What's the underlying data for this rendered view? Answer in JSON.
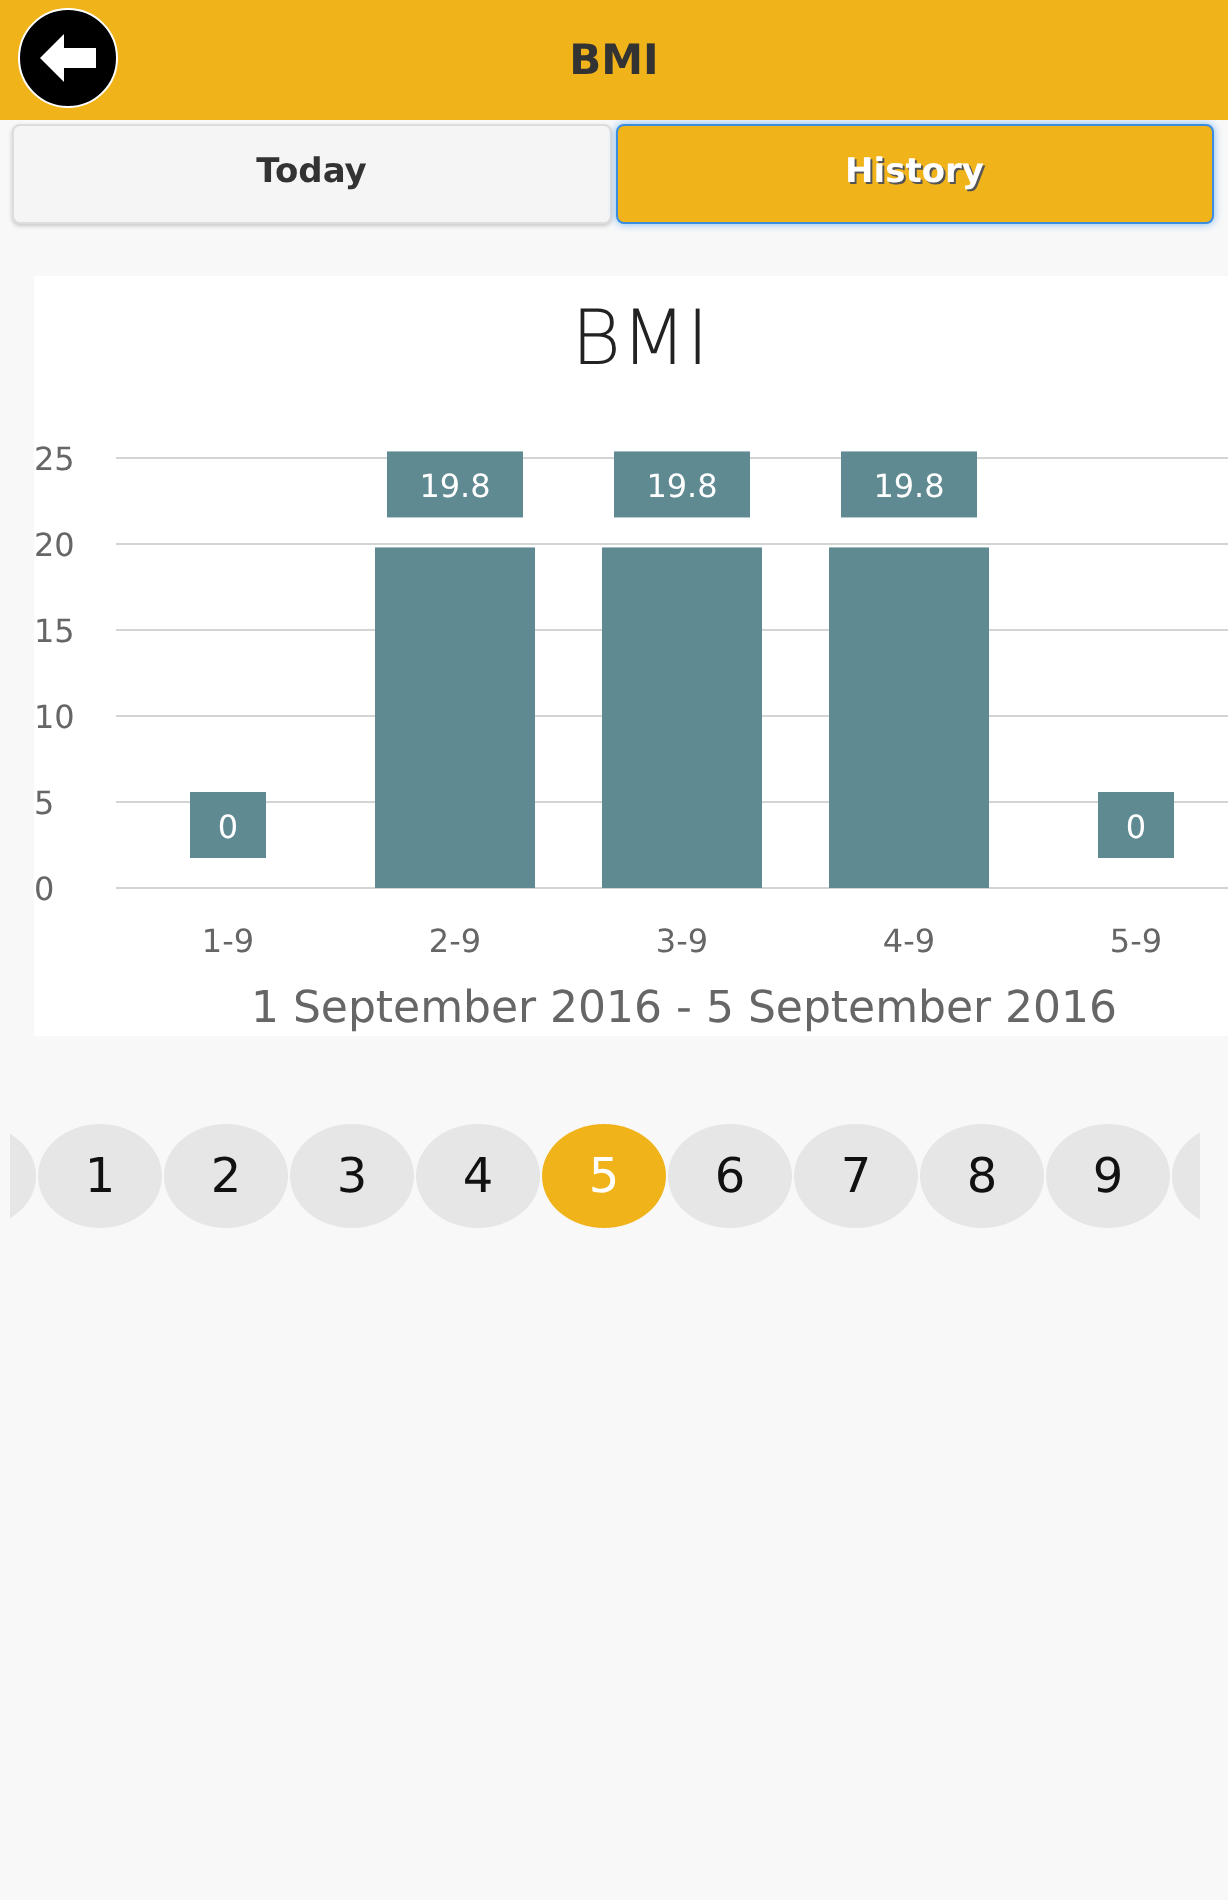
{
  "header": {
    "title": "BMI"
  },
  "tabs": [
    {
      "label": "Today",
      "selected": false
    },
    {
      "label": "History",
      "selected": true
    }
  ],
  "chart_data": {
    "type": "bar",
    "title": "BMI",
    "xlabel": "1 September 2016 - 5 September 2016",
    "categories": [
      "1-9",
      "2-9",
      "3-9",
      "4-9",
      "5-9"
    ],
    "series": [
      {
        "color": "#5f8a92",
        "values": [
          0,
          19.8,
          19.8,
          19.8,
          0
        ]
      }
    ],
    "ylim": [
      0,
      25
    ],
    "yticks": [
      0,
      5,
      10,
      15,
      20,
      25
    ],
    "data_labels": true,
    "grid": true
  },
  "pagination": {
    "clipped_before": true,
    "clipped_after": true,
    "pages": [
      {
        "label": "1",
        "selected": false
      },
      {
        "label": "2",
        "selected": false
      },
      {
        "label": "3",
        "selected": false
      },
      {
        "label": "4",
        "selected": false
      },
      {
        "label": "5",
        "selected": true
      },
      {
        "label": "6",
        "selected": false
      },
      {
        "label": "7",
        "selected": false
      },
      {
        "label": "8",
        "selected": false
      },
      {
        "label": "9",
        "selected": false
      }
    ]
  }
}
